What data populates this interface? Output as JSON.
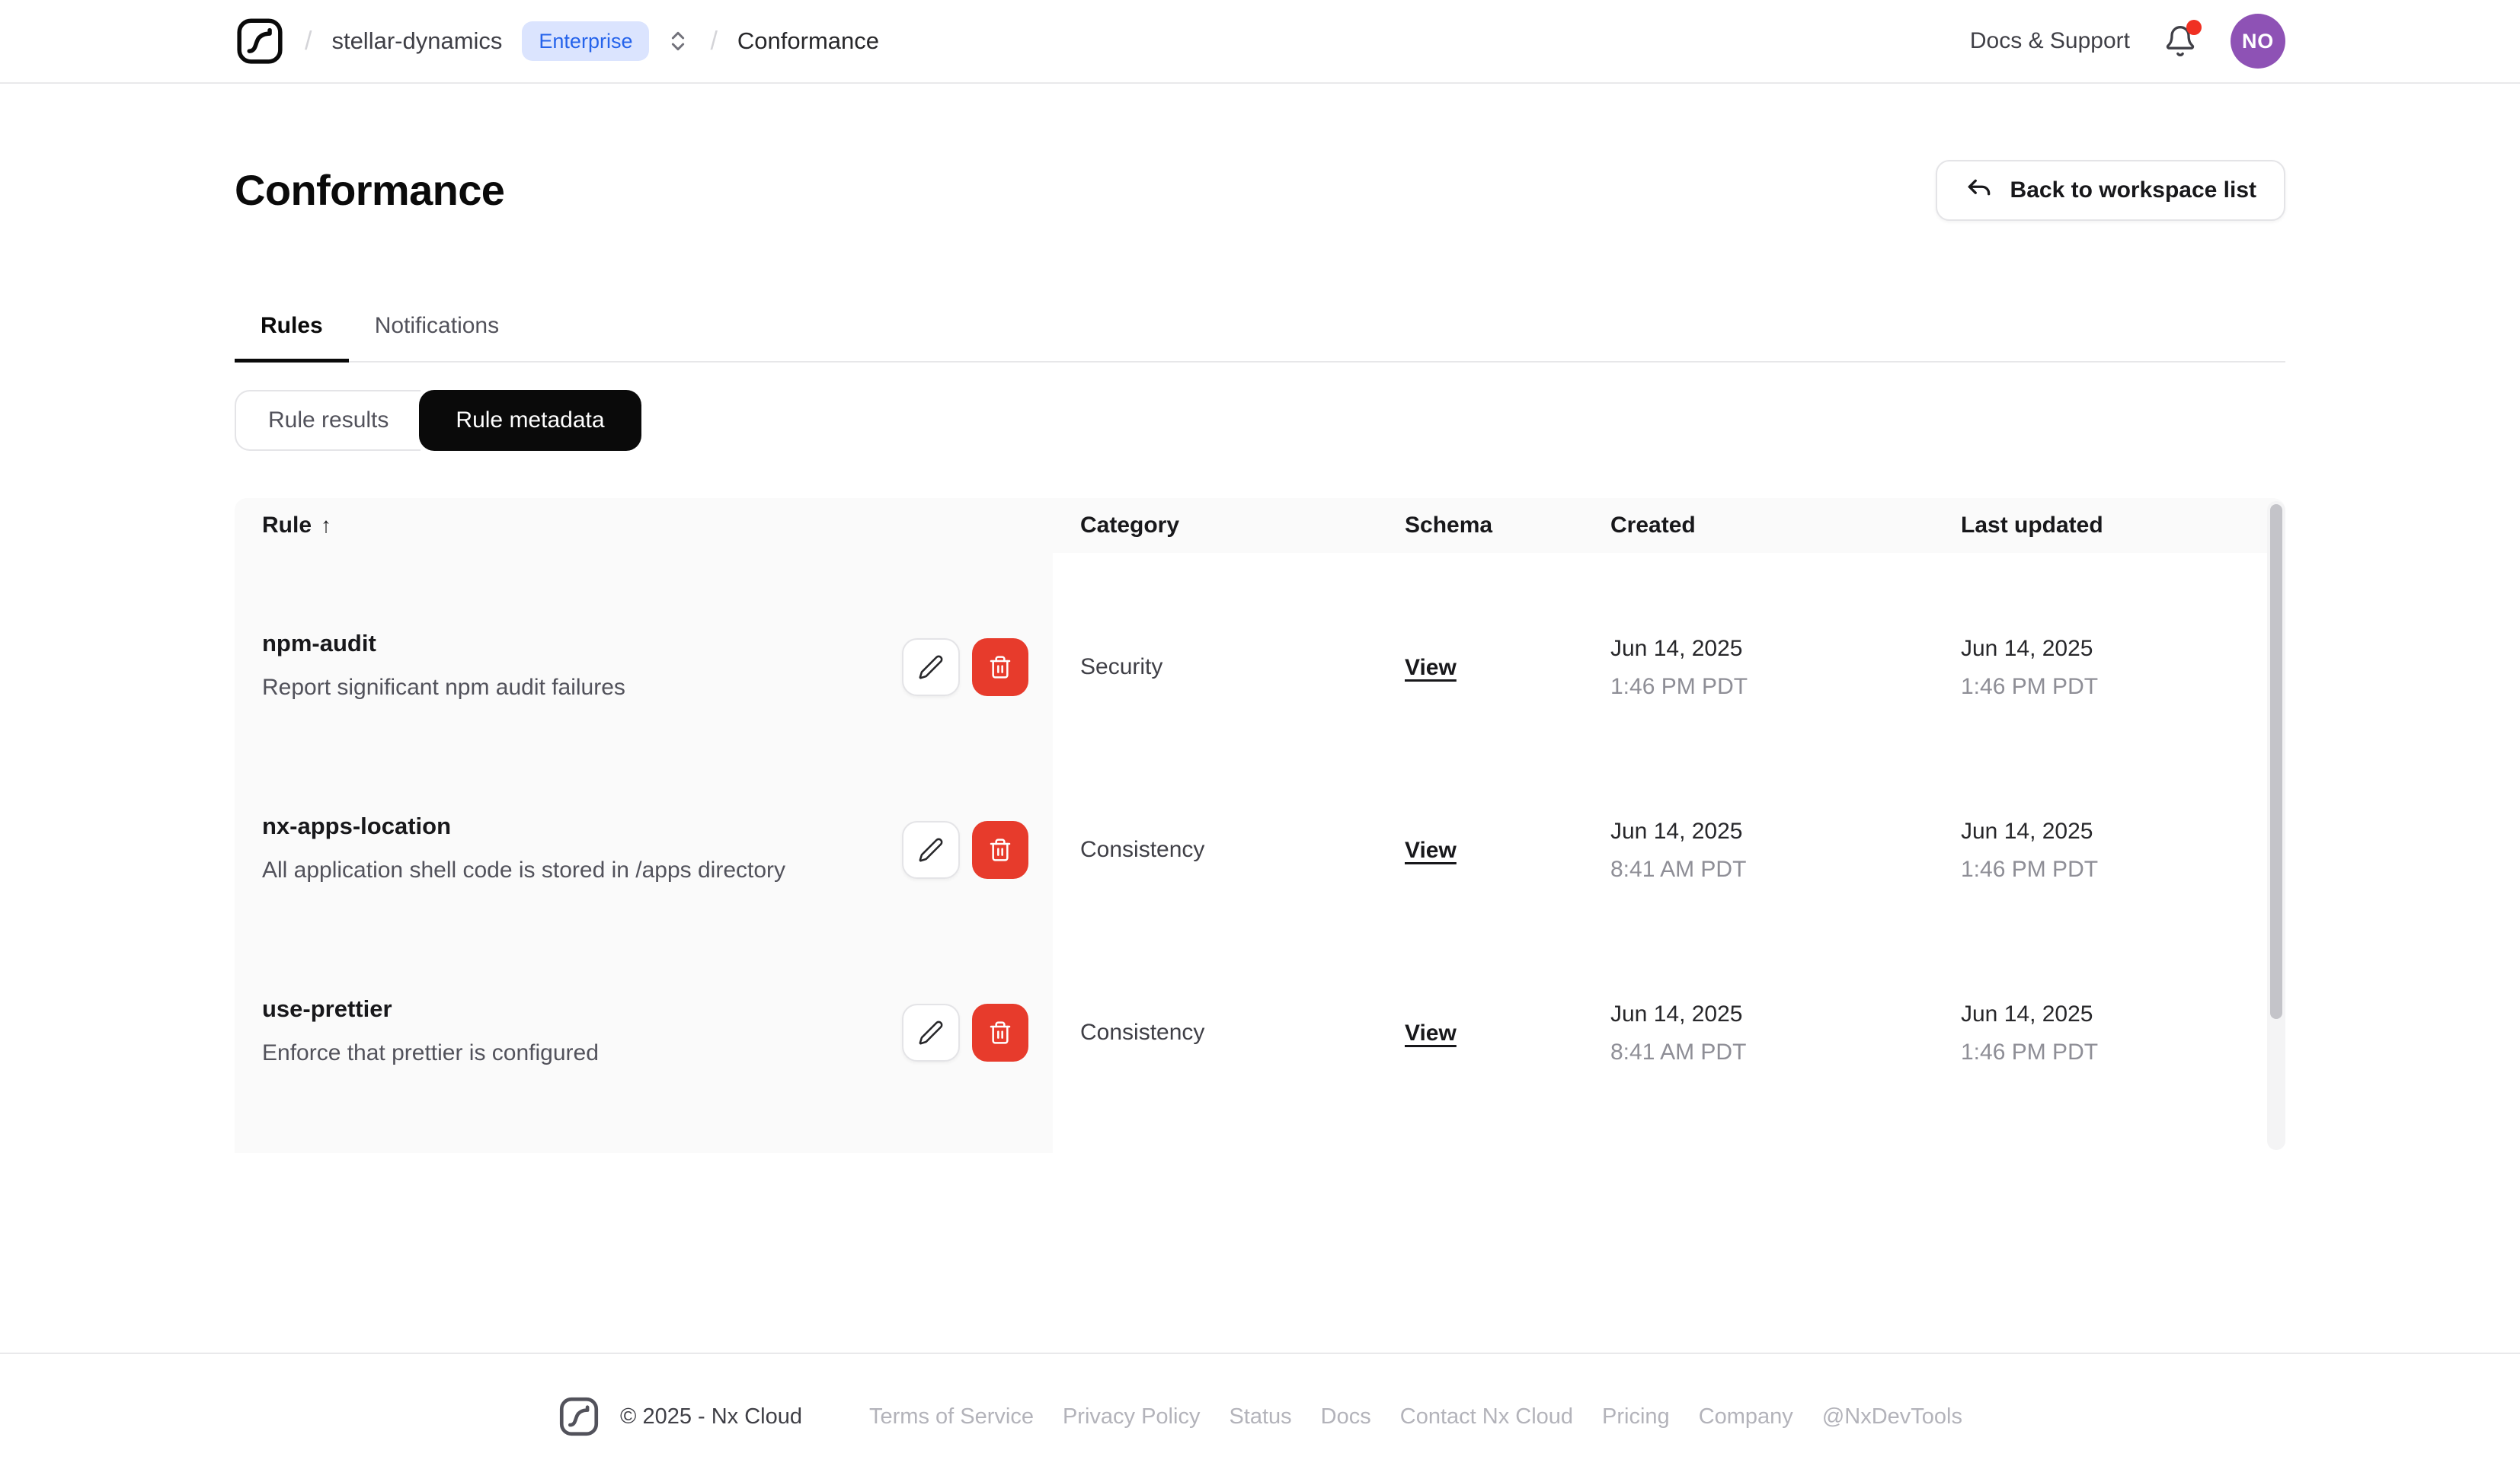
{
  "nav": {
    "separator": "/",
    "workspace": "stellar-dynamics",
    "plan_badge": "Enterprise",
    "page": "Conformance",
    "docs_support": "Docs & Support",
    "avatar_initials": "NO"
  },
  "page": {
    "title": "Conformance",
    "back_button_label": "Back to workspace list"
  },
  "tabs": {
    "rules": "Rules",
    "notifications": "Notifications",
    "active": "Rules"
  },
  "view_toggle": {
    "results": "Rule results",
    "metadata": "Rule metadata",
    "active": "Rule metadata"
  },
  "table": {
    "columns": [
      "Rule",
      "Category",
      "Schema",
      "Created",
      "Last updated"
    ],
    "sort_column": "Rule",
    "sort_indicator": "↑",
    "rows": [
      {
        "name": "npm-audit",
        "description": "Report significant npm audit failures",
        "category": "Security",
        "schema_link": "View",
        "created_date": "Jun 14, 2025",
        "created_time": "1:46 PM PDT",
        "updated_date": "Jun 14, 2025",
        "updated_time": "1:46 PM PDT"
      },
      {
        "name": "nx-apps-location",
        "description": "All application shell code is stored in /apps directory",
        "category": "Consistency",
        "schema_link": "View",
        "created_date": "Jun 14, 2025",
        "created_time": "8:41 AM PDT",
        "updated_date": "Jun 14, 2025",
        "updated_time": "1:46 PM PDT"
      },
      {
        "name": "use-prettier",
        "description": "Enforce that prettier is configured",
        "category": "Consistency",
        "schema_link": "View",
        "created_date": "Jun 14, 2025",
        "created_time": "8:41 AM PDT",
        "updated_date": "Jun 14, 2025",
        "updated_time": "1:46 PM PDT"
      }
    ]
  },
  "footer": {
    "copyright": "© 2025 - Nx Cloud",
    "links": [
      "Terms of Service",
      "Privacy Policy",
      "Status",
      "Docs",
      "Contact Nx Cloud",
      "Pricing",
      "Company",
      "@NxDevTools"
    ]
  },
  "colors": {
    "delete_red": "#e73b2c",
    "avatar_purple": "#8e52b5",
    "badge_bg": "#dbe4fe",
    "badge_text": "#2563eb",
    "notification_dot": "#f03022",
    "active_toggle_bg": "#0a0a0a",
    "table_header_bg": "#fafafa"
  }
}
